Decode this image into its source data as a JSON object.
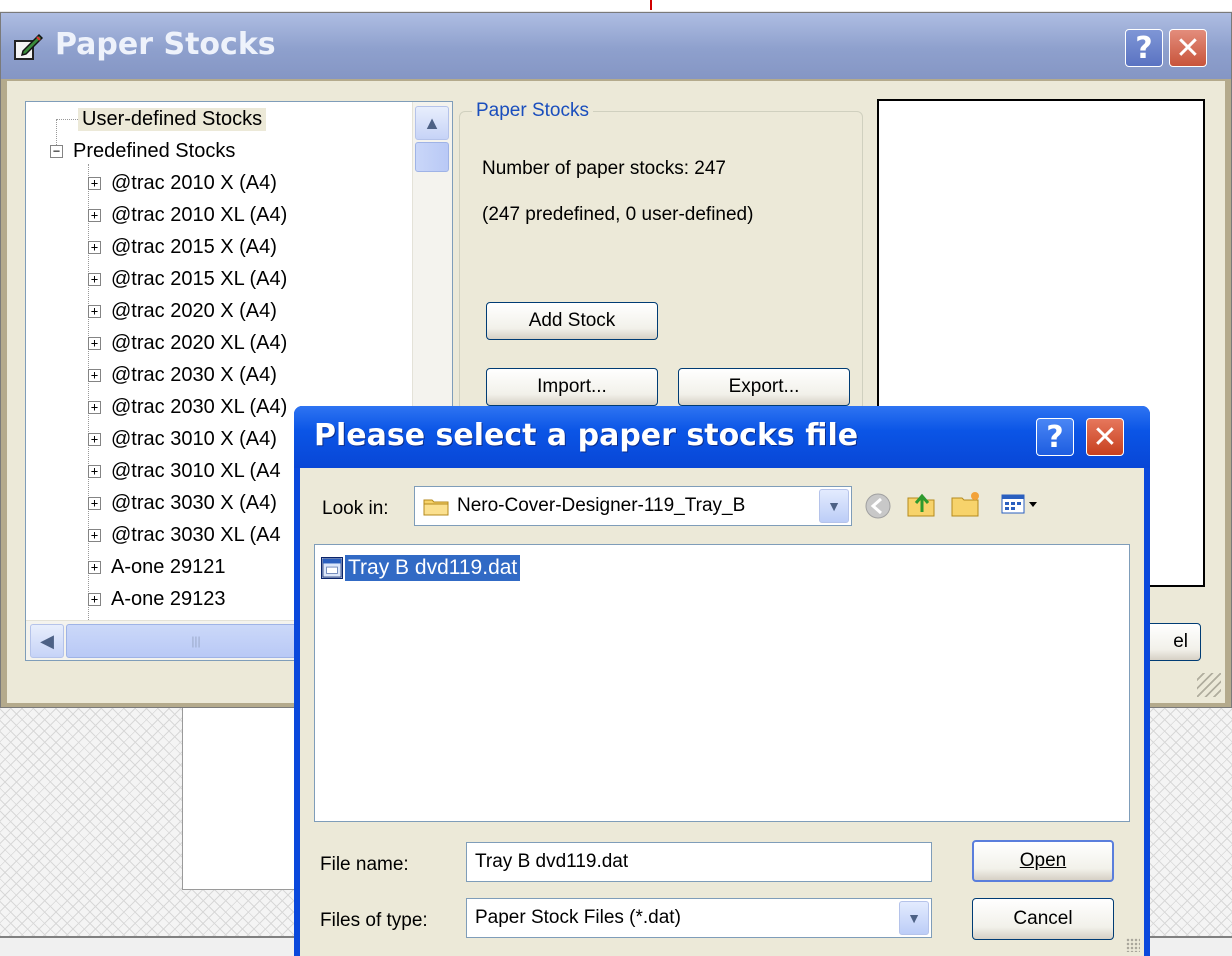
{
  "paper_stocks_dialog": {
    "title": "Paper Stocks",
    "help_label": "?",
    "close_label": "✕",
    "tree": {
      "root_items": [
        {
          "label": "User-defined Stocks",
          "selected": true
        },
        {
          "label": "Predefined Stocks",
          "expanded": true
        }
      ],
      "children": [
        "@trac 2010 X (A4)",
        "@trac 2010 XL (A4)",
        "@trac 2015 X (A4)",
        "@trac 2015 XL (A4)",
        "@trac 2020 X (A4)",
        "@trac 2020 XL (A4)",
        "@trac 2030 X (A4)",
        "@trac 2030 XL (A4)",
        "@trac 3010 X (A4)",
        "@trac 3010 XL (A4",
        "@trac 3030 X (A4)",
        "@trac 3030 XL (A4",
        "A-one 29121",
        "A-one 29123"
      ],
      "expander_plus": "+",
      "expander_minus": "−"
    },
    "group": {
      "title": "Paper Stocks",
      "count_text": "Number of paper stocks: 247",
      "detail_text": "(247 predefined, 0 user-defined)"
    },
    "buttons": {
      "add_stock": "Add Stock",
      "import": "Import...",
      "export": "Export...",
      "cancel_partial": "el"
    }
  },
  "file_dialog": {
    "title": "Please select a paper stocks file",
    "help_label": "?",
    "close_label": "✕",
    "look_in_label": "Look in:",
    "look_in_value": "Nero-Cover-Designer-119_Tray_B",
    "files": [
      {
        "name": "Tray B dvd119.dat",
        "selected": true
      }
    ],
    "file_name_label": "File name:",
    "file_name_value": "Tray B dvd119.dat",
    "files_of_type_label": "Files of type:",
    "files_of_type_value": "Paper Stock Files (*.dat)",
    "open_button": "Open",
    "cancel_button": "Cancel"
  },
  "colors": {
    "xp_blue": "#0a48dc",
    "inactive_title": "#8ea0cd",
    "selection": "#316ac5",
    "dialog_face": "#ece9d8"
  }
}
